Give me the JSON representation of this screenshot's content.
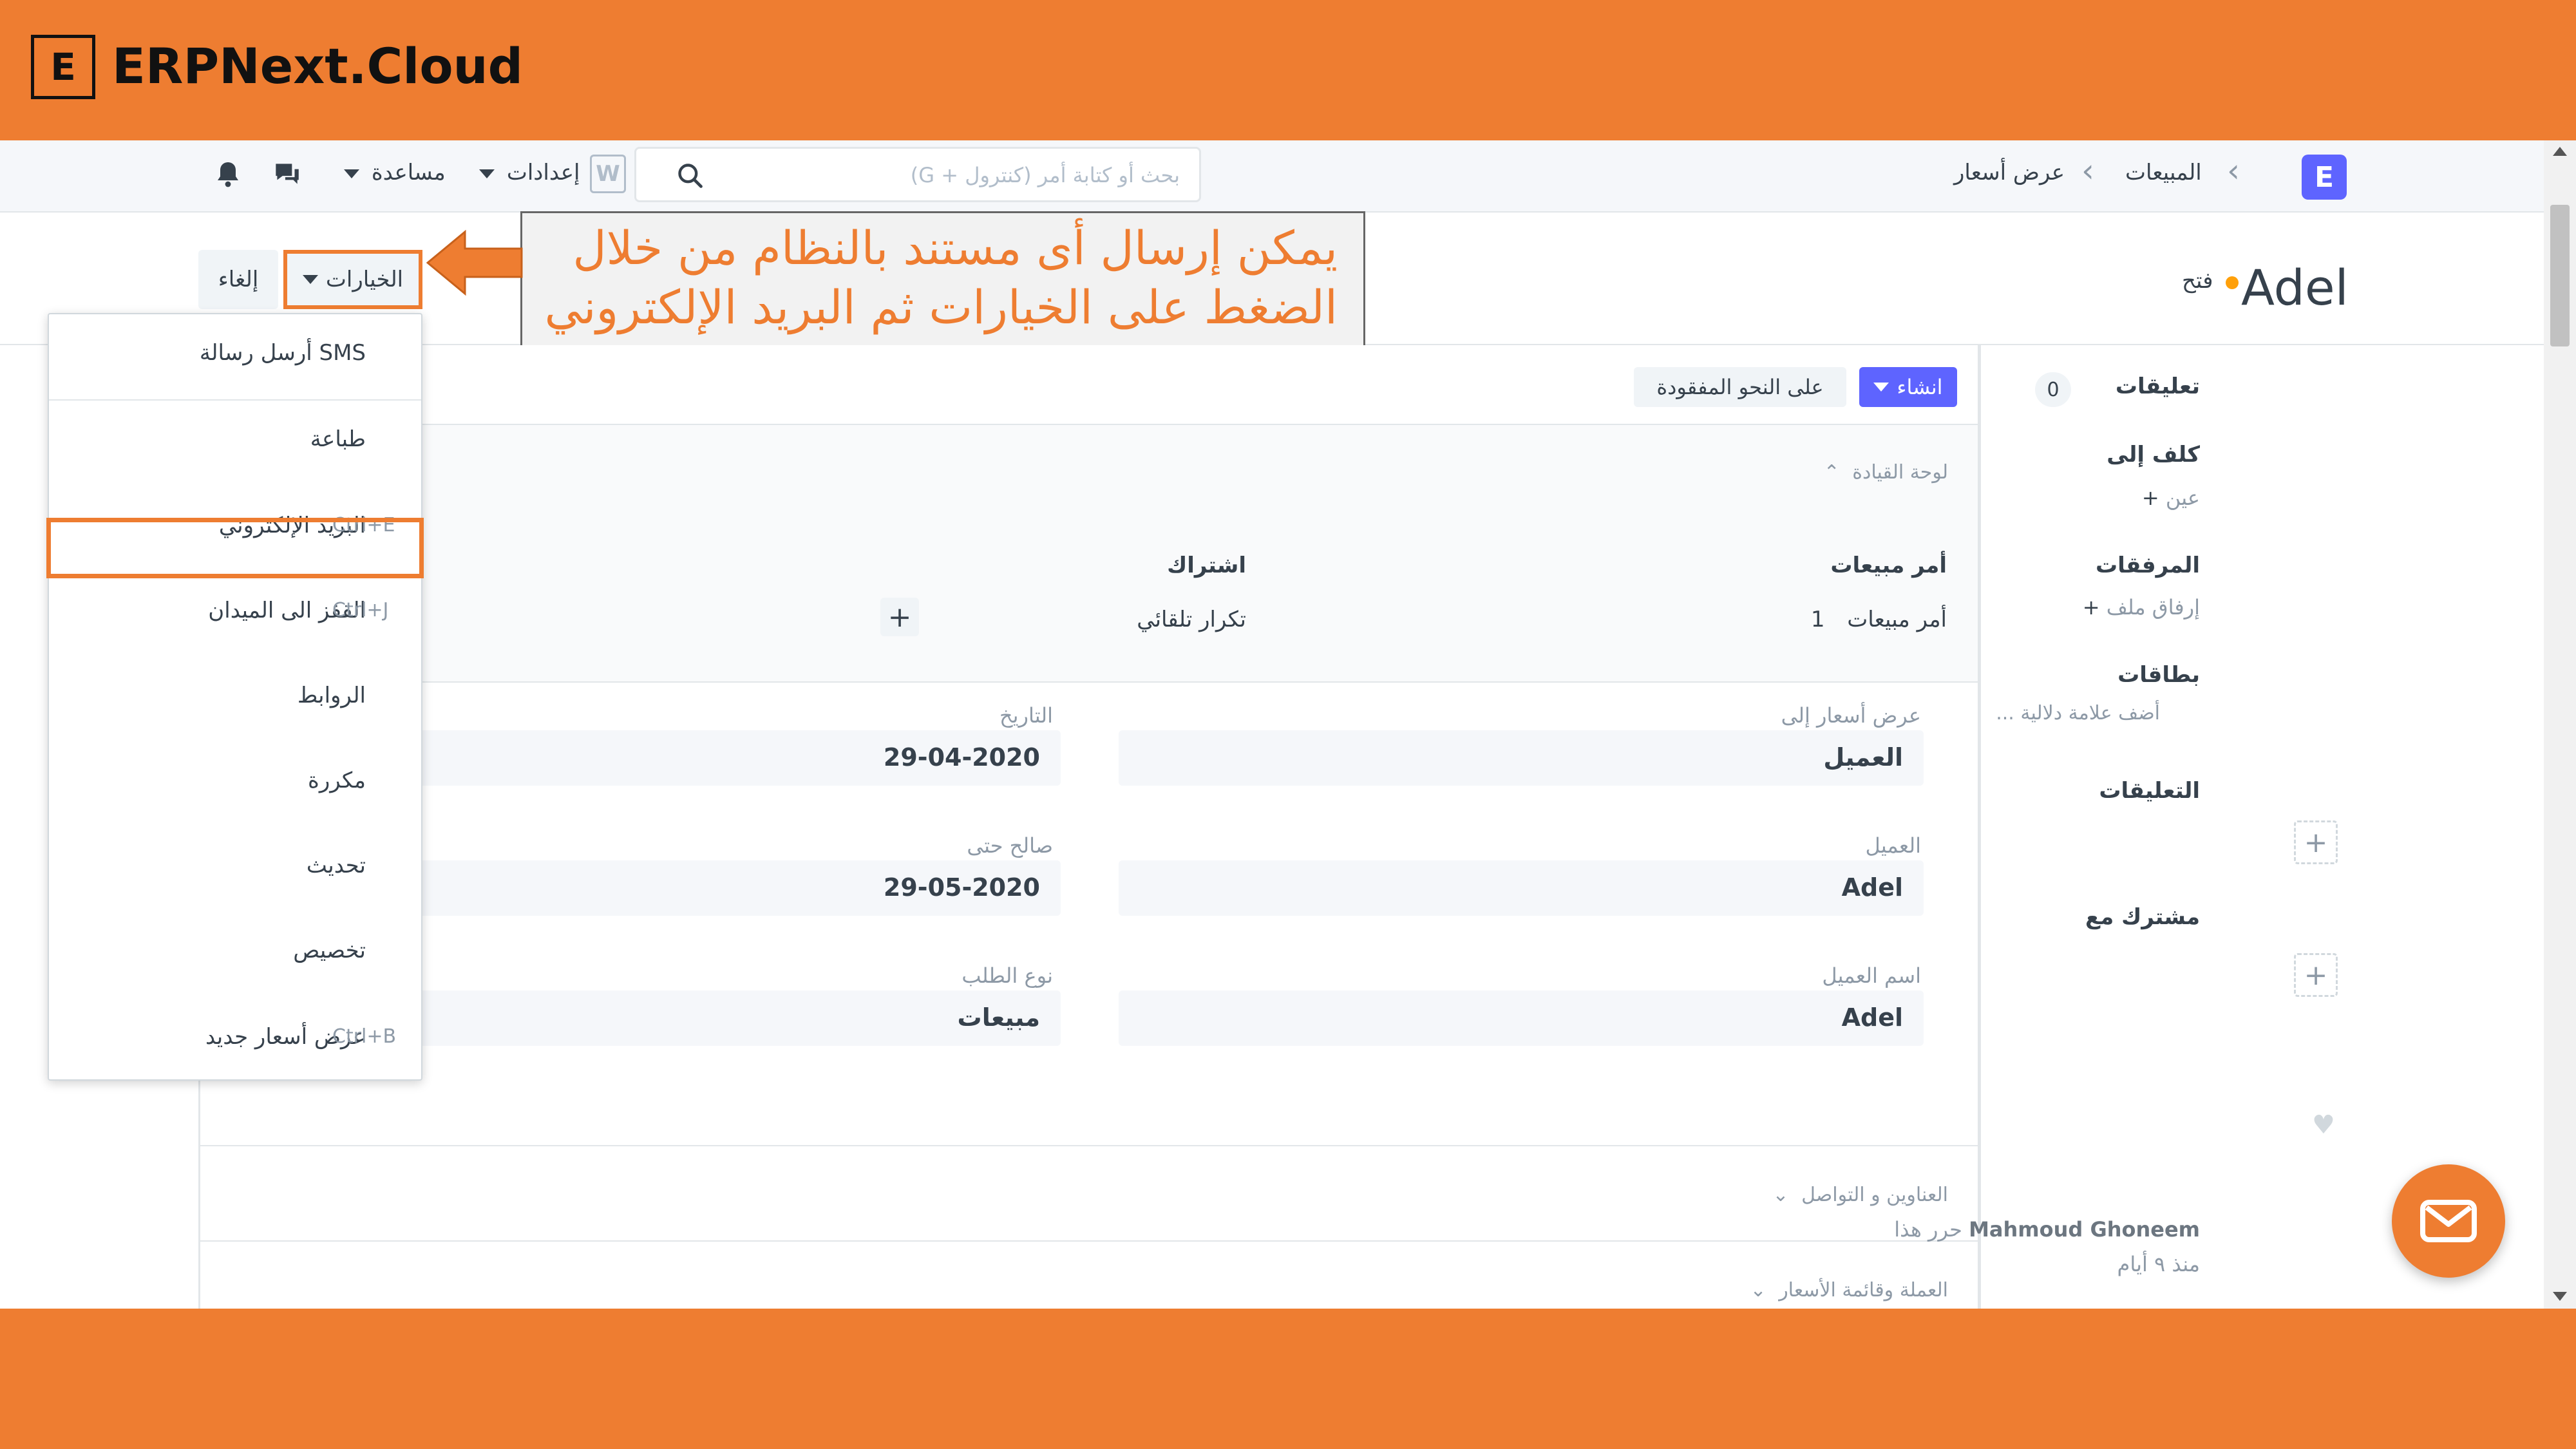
{
  "brand": {
    "logo_letter": "E",
    "name": "ERPNext.Cloud"
  },
  "navbar": {
    "logo_letter": "E",
    "breadcrumbs": [
      "المبيعات",
      "عرض أسعار"
    ],
    "search_placeholder": "بحث أو كتابة أمر (كنترول + G)",
    "settings_label": "إعدادات",
    "settings_badge": "W",
    "help_label": "مساعدة"
  },
  "page": {
    "title": "Adel",
    "status": "فتح",
    "options_button": "الخيارات",
    "cancel_button": "إلغاء"
  },
  "callout": {
    "line1": "يمكن إرسال أى مستند بالنظام من خلال",
    "line2": "الضغط على الخيارات ثم البريد الإلكتروني"
  },
  "toolbar": {
    "create_button": "انشاء",
    "lost_button": "على النحو المفقودة"
  },
  "dashboard": {
    "title": "لوحة القيادة",
    "col1_heading": "أمر مبيعات",
    "col1_link": "أمر مبيعات",
    "col1_count": "1",
    "col2_heading": "اشتراك",
    "col2_link": "تكرار تلقائي"
  },
  "fields": {
    "quotation_to_label": "عرض أسعار إلى",
    "quotation_to_value": "العميل",
    "date_label": "التاريخ",
    "date_value": "29-04-2020",
    "customer_label": "العميل",
    "customer_value": "Adel",
    "valid_till_label": "صالح حتى",
    "valid_till_value": "29-05-2020",
    "customer_name_label": "اسم العميل",
    "customer_name_value": "Adel",
    "order_type_label": "نوع الطلب",
    "order_type_value": "مبيعات"
  },
  "sections": {
    "address_contact": "العناوين و التواصل",
    "currency_pricelist": "العملة وقائمة الأسعار"
  },
  "dropdown": {
    "items": [
      {
        "label": "SMS أرسل رسالة",
        "shortcut": ""
      },
      {
        "label": "طباعة",
        "shortcut": ""
      },
      {
        "label": "البريد الإلكتروني",
        "shortcut": "Ctrl+E"
      },
      {
        "label": "القفز الى الميدان",
        "shortcut": "Ctrl+J"
      },
      {
        "label": "الروابط",
        "shortcut": ""
      },
      {
        "label": "مكررة",
        "shortcut": ""
      },
      {
        "label": "تحديث",
        "shortcut": ""
      },
      {
        "label": "تخصيص",
        "shortcut": ""
      },
      {
        "label": "عرض أسعار جديد",
        "shortcut": "Ctrl+B"
      }
    ]
  },
  "sidebar": {
    "comments_heading": "تعليقات",
    "comments_count": "0",
    "assign_heading": "كلف إلى",
    "assign_link": "عين",
    "attachments_heading": "المرفقات",
    "attach_link": "إرفاق ملف",
    "tags_heading": "بطاقات",
    "tags_link": "أضف علامة دلالية ...",
    "reviews_heading": "التعليقات",
    "shared_heading": "مشترك مع",
    "activity_user": "Mahmoud Ghoneem",
    "activity_action": "حرر هذا",
    "activity_time": "منذ ٩ أيام"
  },
  "colors": {
    "brand_orange": "#ee7d31",
    "primary": "#5e64ff",
    "status_open": "#ffa00a"
  }
}
